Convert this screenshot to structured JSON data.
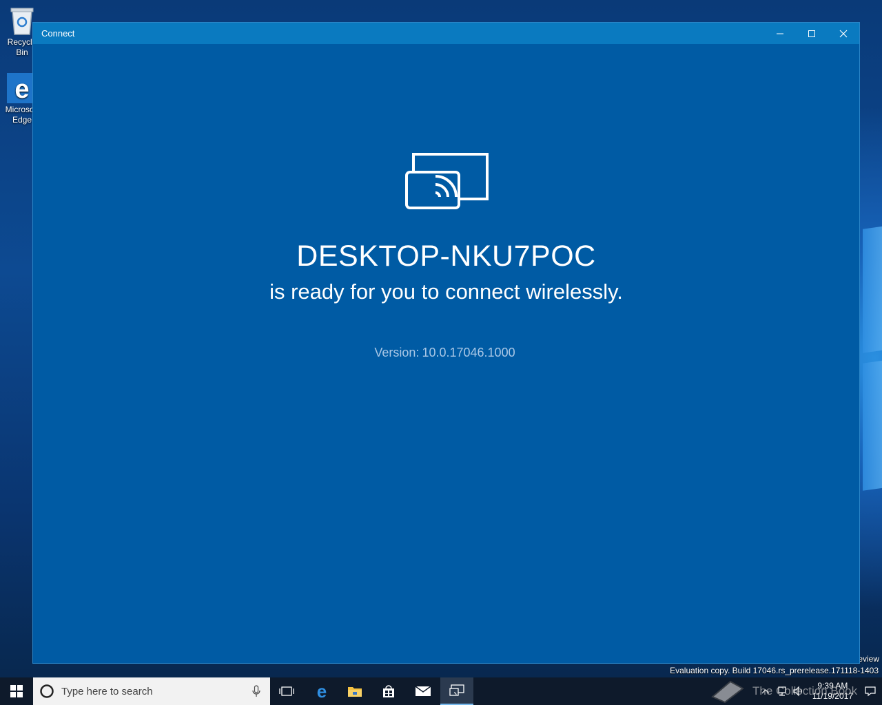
{
  "desktop": {
    "icons": [
      {
        "label": "Recycle Bin"
      },
      {
        "label": "Microsoft Edge"
      }
    ],
    "watermark": {
      "preview": "eview",
      "build": "Evaluation copy. Build 17046.rs_prerelease.171118-1403"
    }
  },
  "window": {
    "title": "Connect",
    "device_name": "DESKTOP-NKU7POC",
    "status": "is ready for you to connect wirelessly.",
    "version_label": "Version:",
    "version_value": "10.0.17046.1000",
    "icon": "cast-screen-icon"
  },
  "taskbar": {
    "search_placeholder": "Type here to search",
    "pinned": [
      "task-view-icon",
      "edge-icon",
      "file-explorer-icon",
      "store-icon",
      "mail-icon",
      "connect-icon"
    ],
    "clock_time": "9:39 AM",
    "clock_date": "11/19/2017",
    "overlay_text": "The Collection Book"
  },
  "colors": {
    "window_bg": "#005ba4",
    "titlebar_bg": "#0a7ac0",
    "taskbar_bg": "#0e1a2b",
    "version_text": "#a9c7e6"
  }
}
